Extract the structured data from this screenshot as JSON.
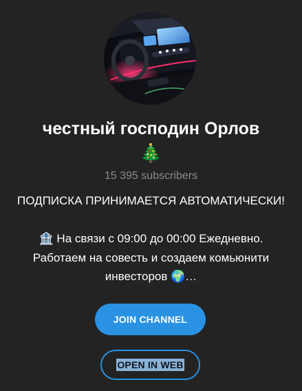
{
  "channel": {
    "title": "честный господин Орлов",
    "title_emoji": "🎄",
    "subscribers": "15 395 subscribers",
    "description": {
      "line1": "ПОДПИСКА ПРИНИМАЕТСЯ АВТОМАТИЧЕСКИ!",
      "line2": "🏦 На связи с 09:00 до 00:00 Ежедневно.",
      "line3": "Работаем на совесть и создаем комьюнити",
      "line4": "инвесторов 🌍…"
    }
  },
  "buttons": {
    "join_label": "JOIN CHANNEL",
    "open_web_label": "OPEN IN WEB"
  },
  "colors": {
    "background": "#232323",
    "accent": "#2a92e3",
    "muted_text": "#8c8c8c"
  },
  "icons": {
    "avatar": "car-interior-avatar"
  }
}
